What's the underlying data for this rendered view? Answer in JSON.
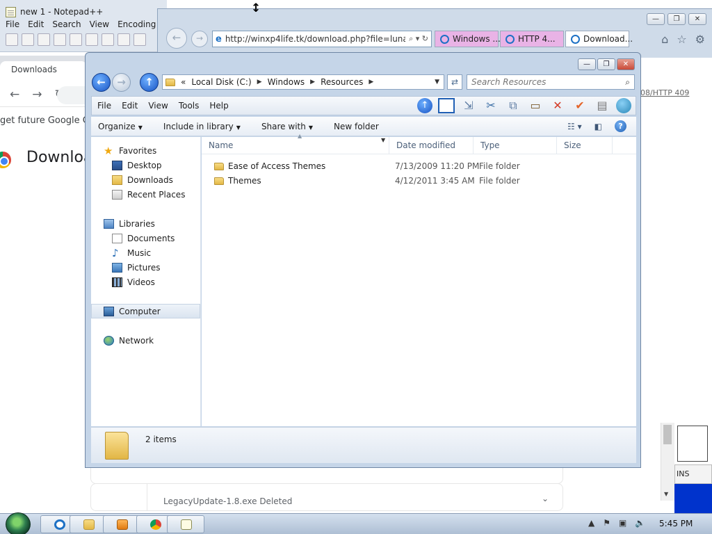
{
  "notepad": {
    "title": "new 1 - Notepad++",
    "menu": [
      "File",
      "Edit",
      "Search",
      "View",
      "Encoding"
    ]
  },
  "chrome": {
    "tab_title": "Downloads",
    "banner_text": "get future Google Ch",
    "page_heading": "Downloa",
    "download_item_text": "LegacyUpdate-1.8.exe   Deleted"
  },
  "ie": {
    "address": "http://winxp4life.tk/download.php?file=luna",
    "tabs": [
      "Windows ...",
      "HTTP 4...",
      "Download..."
    ],
    "content_link": "08/HTTP 409",
    "caption_buttons": [
      "—",
      "❐",
      "✕"
    ]
  },
  "explorer": {
    "breadcrumb": [
      "Local Disk (C:)",
      "Windows",
      "Resources"
    ],
    "search_placeholder": "Search Resources",
    "menu": [
      "File",
      "Edit",
      "View",
      "Tools",
      "Help"
    ],
    "commands": {
      "organize": "Organize",
      "include": "Include in library",
      "share": "Share with",
      "new_folder": "New folder"
    },
    "nav": {
      "favorites": "Favorites",
      "desktop": "Desktop",
      "downloads": "Downloads",
      "recent": "Recent Places",
      "libraries": "Libraries",
      "documents": "Documents",
      "music": "Music",
      "pictures": "Pictures",
      "videos": "Videos",
      "computer": "Computer",
      "network": "Network"
    },
    "columns": {
      "name": "Name",
      "date": "Date modified",
      "type": "Type",
      "size": "Size"
    },
    "files": [
      {
        "name": "Ease of Access Themes",
        "date": "7/13/2009 11:20 PM",
        "type": "File folder"
      },
      {
        "name": "Themes",
        "date": "4/12/2011 3:45 AM",
        "type": "File folder"
      }
    ],
    "item_count": "2 items"
  },
  "side_label": "INS",
  "taskbar": {
    "clock": "5:45 PM"
  }
}
